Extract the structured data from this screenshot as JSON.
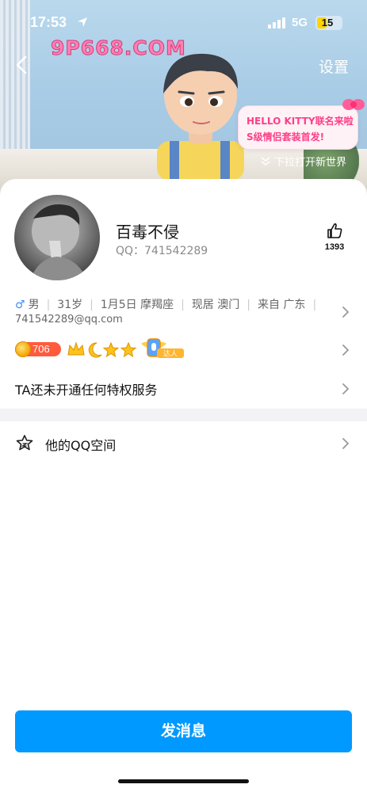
{
  "status_bar": {
    "time": "17:53",
    "network": "5G",
    "battery": "15"
  },
  "watermark": {
    "text": "9P668.COM"
  },
  "header": {
    "settings_label": "设置"
  },
  "promo": {
    "text": "HELLO KITTY联名来啦 S级情侣套装首发!"
  },
  "pull_hint": "下拉打开新世界",
  "profile": {
    "name": "百毒不侵",
    "qq": "QQ：741542289",
    "likes": "1393",
    "gender": "男",
    "age": "31岁",
    "birthday": "1月5日 摩羯座",
    "current_city": "现居 澳门",
    "hometown": "来自 广东",
    "email": "741542289@qq.com"
  },
  "badges": {
    "level": "706",
    "daren_label": "达人"
  },
  "vip_text": "TA还未开通任何特权服务",
  "qzone_label": "他的QQ空间",
  "send_button": "发消息",
  "colors": {
    "primary_button": "#0099ff",
    "promo_text": "#ff3f86",
    "male_symbol": "#3d8cff"
  },
  "icons": [
    "location-arrow-icon",
    "signal-icon",
    "battery-icon",
    "back-icon",
    "thumbs-up-icon",
    "chevron-right-icon",
    "star-icon",
    "crown-icon",
    "moon-icon",
    "level-coin-icon"
  ]
}
